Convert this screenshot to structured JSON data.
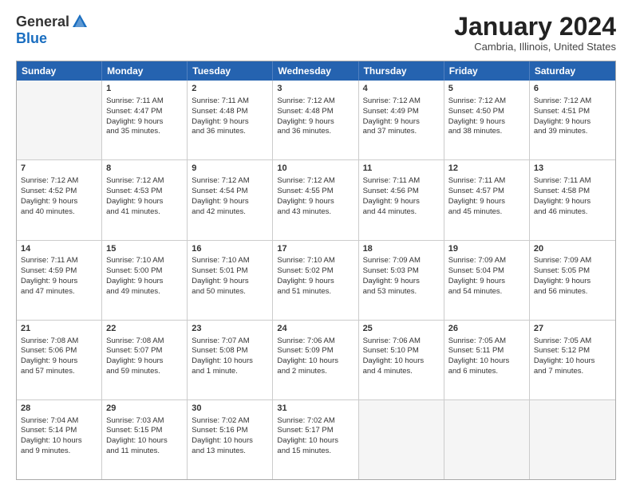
{
  "logo": {
    "general": "General",
    "blue": "Blue"
  },
  "title": "January 2024",
  "location": "Cambria, Illinois, United States",
  "days": [
    "Sunday",
    "Monday",
    "Tuesday",
    "Wednesday",
    "Thursday",
    "Friday",
    "Saturday"
  ],
  "weeks": [
    [
      {
        "day": "",
        "info": ""
      },
      {
        "day": "1",
        "info": "Sunrise: 7:11 AM\nSunset: 4:47 PM\nDaylight: 9 hours\nand 35 minutes."
      },
      {
        "day": "2",
        "info": "Sunrise: 7:11 AM\nSunset: 4:48 PM\nDaylight: 9 hours\nand 36 minutes."
      },
      {
        "day": "3",
        "info": "Sunrise: 7:12 AM\nSunset: 4:48 PM\nDaylight: 9 hours\nand 36 minutes."
      },
      {
        "day": "4",
        "info": "Sunrise: 7:12 AM\nSunset: 4:49 PM\nDaylight: 9 hours\nand 37 minutes."
      },
      {
        "day": "5",
        "info": "Sunrise: 7:12 AM\nSunset: 4:50 PM\nDaylight: 9 hours\nand 38 minutes."
      },
      {
        "day": "6",
        "info": "Sunrise: 7:12 AM\nSunset: 4:51 PM\nDaylight: 9 hours\nand 39 minutes."
      }
    ],
    [
      {
        "day": "7",
        "info": "Sunrise: 7:12 AM\nSunset: 4:52 PM\nDaylight: 9 hours\nand 40 minutes."
      },
      {
        "day": "8",
        "info": "Sunrise: 7:12 AM\nSunset: 4:53 PM\nDaylight: 9 hours\nand 41 minutes."
      },
      {
        "day": "9",
        "info": "Sunrise: 7:12 AM\nSunset: 4:54 PM\nDaylight: 9 hours\nand 42 minutes."
      },
      {
        "day": "10",
        "info": "Sunrise: 7:12 AM\nSunset: 4:55 PM\nDaylight: 9 hours\nand 43 minutes."
      },
      {
        "day": "11",
        "info": "Sunrise: 7:11 AM\nSunset: 4:56 PM\nDaylight: 9 hours\nand 44 minutes."
      },
      {
        "day": "12",
        "info": "Sunrise: 7:11 AM\nSunset: 4:57 PM\nDaylight: 9 hours\nand 45 minutes."
      },
      {
        "day": "13",
        "info": "Sunrise: 7:11 AM\nSunset: 4:58 PM\nDaylight: 9 hours\nand 46 minutes."
      }
    ],
    [
      {
        "day": "14",
        "info": "Sunrise: 7:11 AM\nSunset: 4:59 PM\nDaylight: 9 hours\nand 47 minutes."
      },
      {
        "day": "15",
        "info": "Sunrise: 7:10 AM\nSunset: 5:00 PM\nDaylight: 9 hours\nand 49 minutes."
      },
      {
        "day": "16",
        "info": "Sunrise: 7:10 AM\nSunset: 5:01 PM\nDaylight: 9 hours\nand 50 minutes."
      },
      {
        "day": "17",
        "info": "Sunrise: 7:10 AM\nSunset: 5:02 PM\nDaylight: 9 hours\nand 51 minutes."
      },
      {
        "day": "18",
        "info": "Sunrise: 7:09 AM\nSunset: 5:03 PM\nDaylight: 9 hours\nand 53 minutes."
      },
      {
        "day": "19",
        "info": "Sunrise: 7:09 AM\nSunset: 5:04 PM\nDaylight: 9 hours\nand 54 minutes."
      },
      {
        "day": "20",
        "info": "Sunrise: 7:09 AM\nSunset: 5:05 PM\nDaylight: 9 hours\nand 56 minutes."
      }
    ],
    [
      {
        "day": "21",
        "info": "Sunrise: 7:08 AM\nSunset: 5:06 PM\nDaylight: 9 hours\nand 57 minutes."
      },
      {
        "day": "22",
        "info": "Sunrise: 7:08 AM\nSunset: 5:07 PM\nDaylight: 9 hours\nand 59 minutes."
      },
      {
        "day": "23",
        "info": "Sunrise: 7:07 AM\nSunset: 5:08 PM\nDaylight: 10 hours\nand 1 minute."
      },
      {
        "day": "24",
        "info": "Sunrise: 7:06 AM\nSunset: 5:09 PM\nDaylight: 10 hours\nand 2 minutes."
      },
      {
        "day": "25",
        "info": "Sunrise: 7:06 AM\nSunset: 5:10 PM\nDaylight: 10 hours\nand 4 minutes."
      },
      {
        "day": "26",
        "info": "Sunrise: 7:05 AM\nSunset: 5:11 PM\nDaylight: 10 hours\nand 6 minutes."
      },
      {
        "day": "27",
        "info": "Sunrise: 7:05 AM\nSunset: 5:12 PM\nDaylight: 10 hours\nand 7 minutes."
      }
    ],
    [
      {
        "day": "28",
        "info": "Sunrise: 7:04 AM\nSunset: 5:14 PM\nDaylight: 10 hours\nand 9 minutes."
      },
      {
        "day": "29",
        "info": "Sunrise: 7:03 AM\nSunset: 5:15 PM\nDaylight: 10 hours\nand 11 minutes."
      },
      {
        "day": "30",
        "info": "Sunrise: 7:02 AM\nSunset: 5:16 PM\nDaylight: 10 hours\nand 13 minutes."
      },
      {
        "day": "31",
        "info": "Sunrise: 7:02 AM\nSunset: 5:17 PM\nDaylight: 10 hours\nand 15 minutes."
      },
      {
        "day": "",
        "info": ""
      },
      {
        "day": "",
        "info": ""
      },
      {
        "day": "",
        "info": ""
      }
    ]
  ]
}
